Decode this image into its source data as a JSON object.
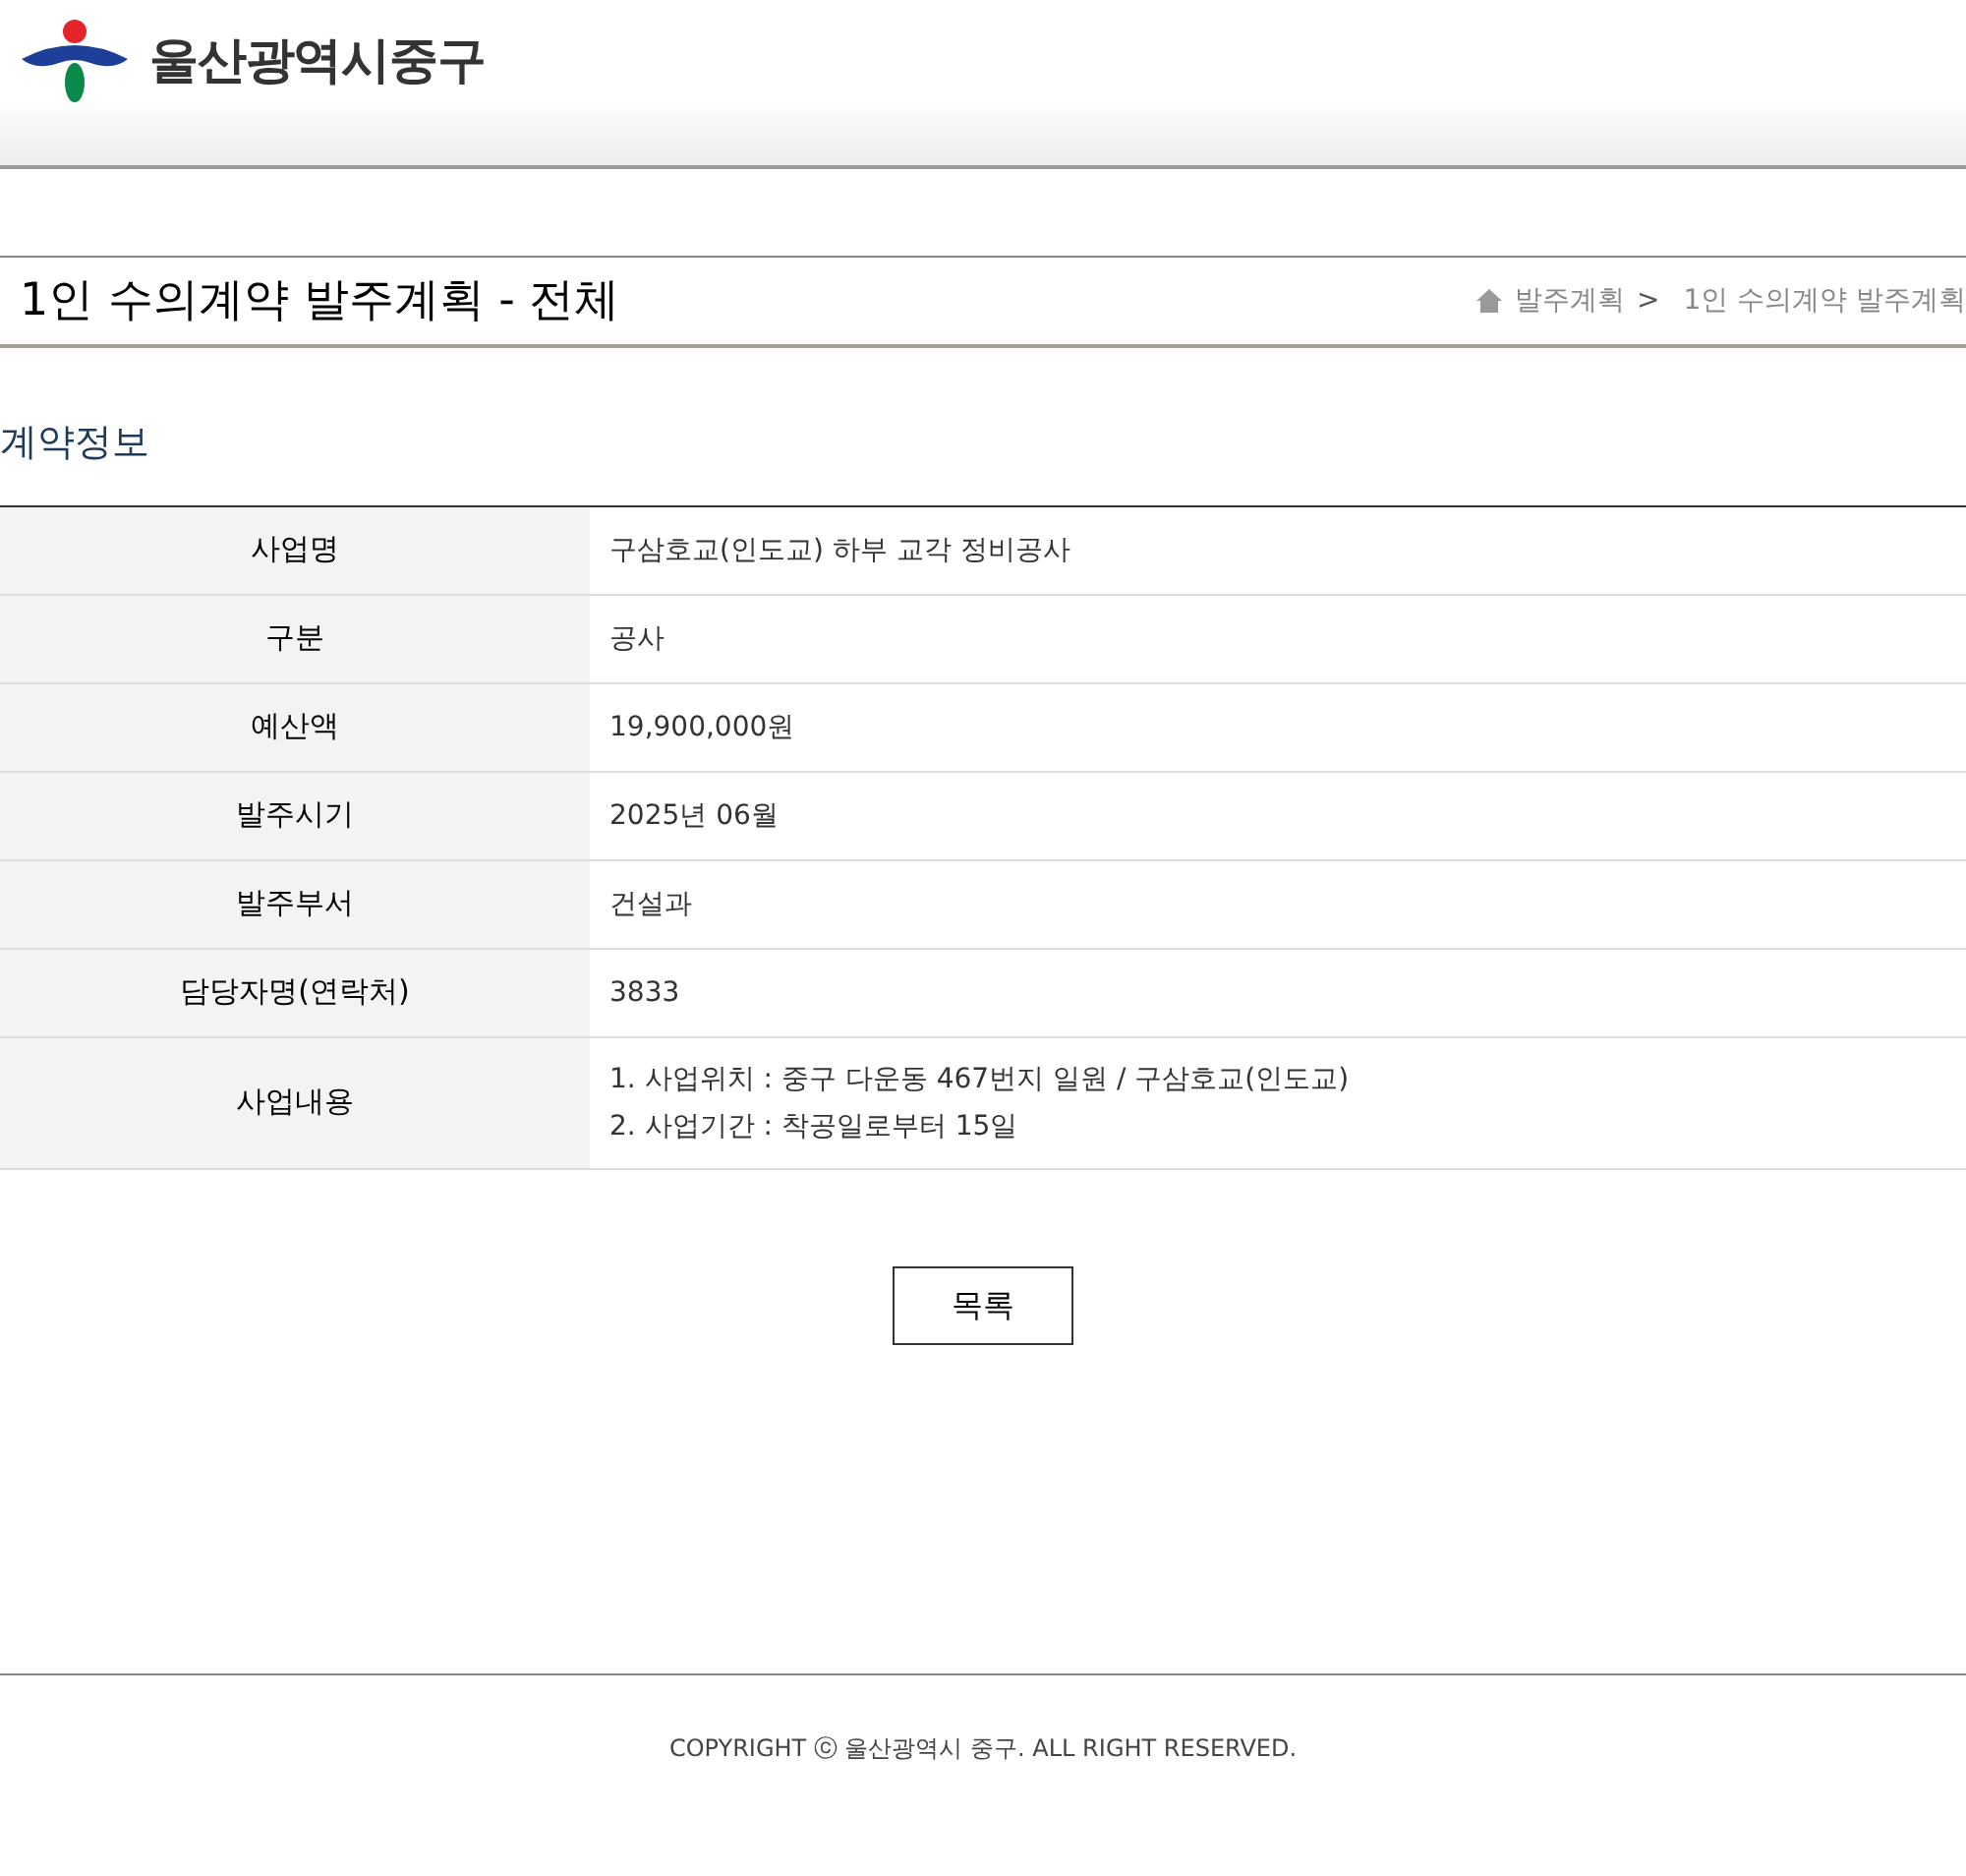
{
  "header": {
    "logo_text": "울산광역시중구"
  },
  "page_title": "1인 수의계약 발주계획 - 전체",
  "breadcrumb": [
    "발주계획",
    ">",
    "1인 수의계약 발주계획"
  ],
  "section_title": "계약정보",
  "rows": [
    {
      "label": "사업명",
      "lines": [
        "구삼호교(인도교) 하부 교각 정비공사"
      ]
    },
    {
      "label": "구분",
      "lines": [
        "공사"
      ]
    },
    {
      "label": "예산액",
      "lines": [
        "19,900,000원"
      ]
    },
    {
      "label": "발주시기",
      "lines": [
        "2025년 06월"
      ]
    },
    {
      "label": "발주부서",
      "lines": [
        "건설과"
      ]
    },
    {
      "label": "담당자명(연락처)",
      "lines": [
        "3833"
      ]
    },
    {
      "label": "사업내용",
      "lines": [
        "1. 사업위치 : 중구 다운동 467번지 일원 / 구삼호교(인도교)",
        "2. 사업기간 : 착공일로부터 15일"
      ]
    }
  ],
  "list_button": "목록",
  "footer": "COPYRIGHT ⓒ 울산광역시 중구. ALL RIGHT RESERVED."
}
